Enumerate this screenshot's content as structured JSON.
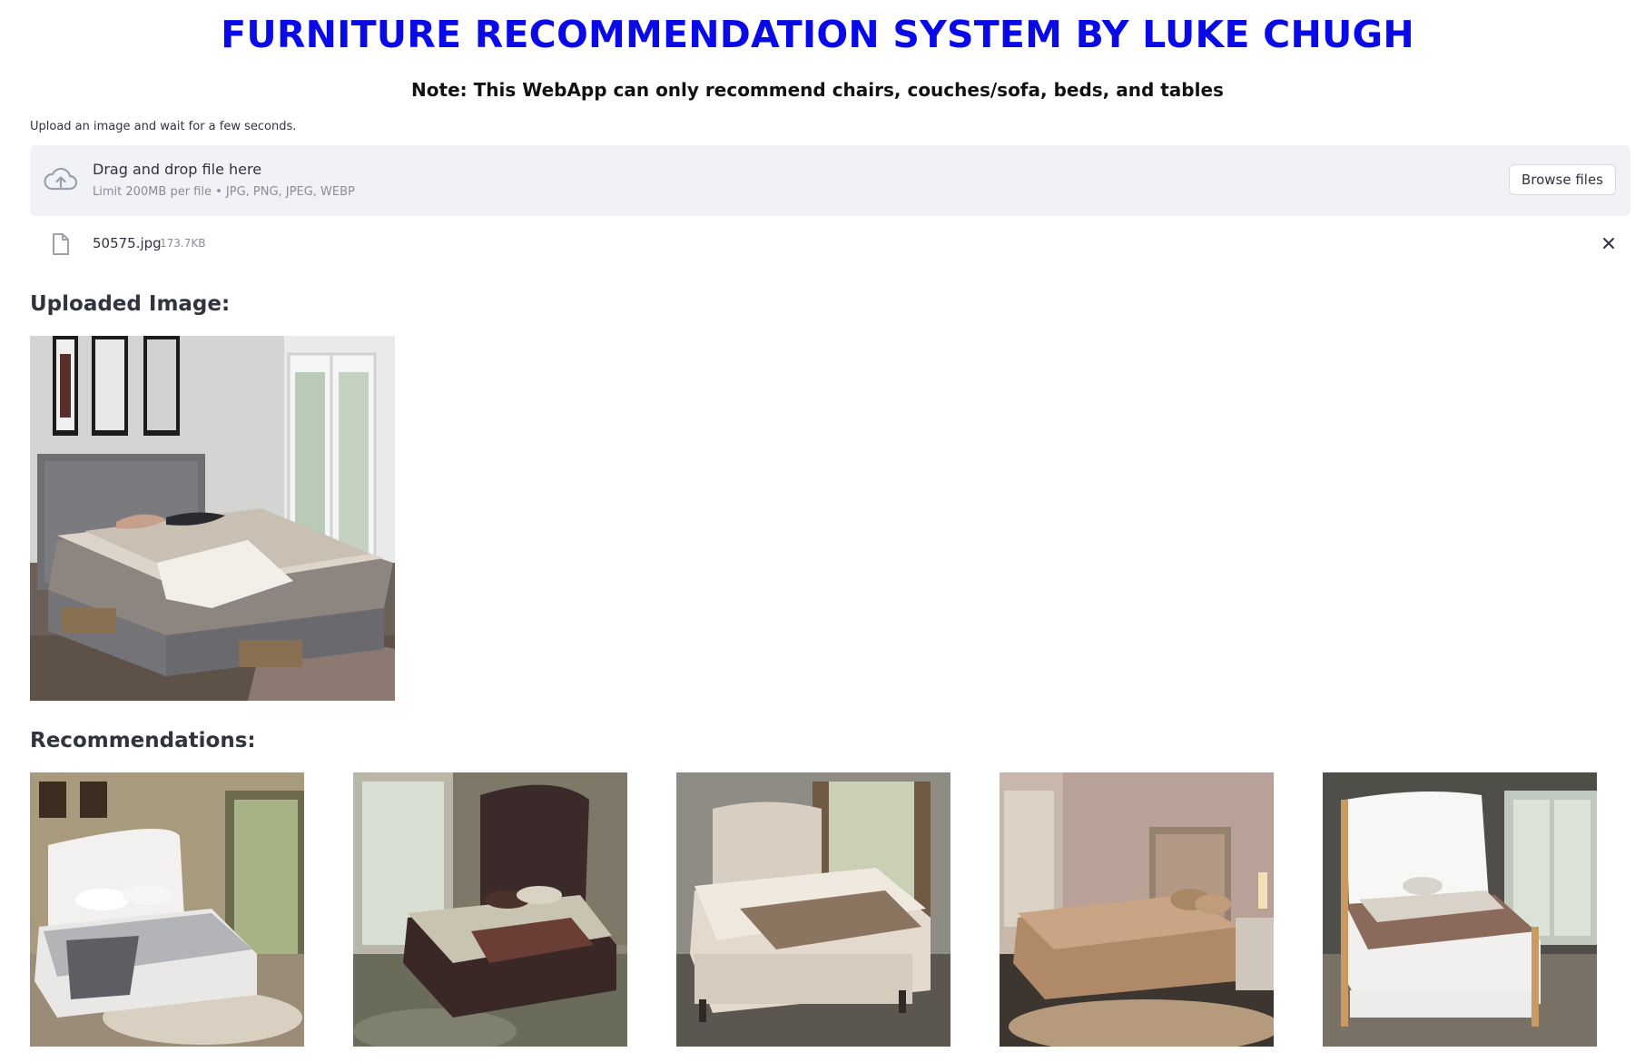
{
  "app": {
    "title": "FURNITURE RECOMMENDATION SYSTEM BY LUKE CHUGH",
    "note": "Note: This WebApp can only recommend chairs, couches/sofa, beds, and tables"
  },
  "uploader": {
    "label": "Upload an image and wait for a few seconds.",
    "drop_title": "Drag and drop file here",
    "drop_subtitle": "Limit 200MB per file • JPG, PNG, JPEG, WEBP",
    "browse_label": "Browse files"
  },
  "uploaded_file": {
    "name": "50575.jpg",
    "size": "173.7KB"
  },
  "sections": {
    "uploaded_heading": "Uploaded Image:",
    "recommendations_heading": "Recommendations:"
  },
  "recommendations": [
    {
      "image": "white tufted bed photo"
    },
    {
      "image": "dark brown tufted bed photo"
    },
    {
      "image": "beige upholstered bed photo"
    },
    {
      "image": "champagne bed photo"
    },
    {
      "image": "white wood bed photo"
    }
  ],
  "colors": {
    "title": "#0a0ae6",
    "dropzone_bg": "#f0f2f6",
    "text": "#31333f",
    "muted": "#8a8d97"
  },
  "icons": {
    "upload": "cloud-upload-icon",
    "file": "file-icon",
    "remove": "close-icon"
  }
}
